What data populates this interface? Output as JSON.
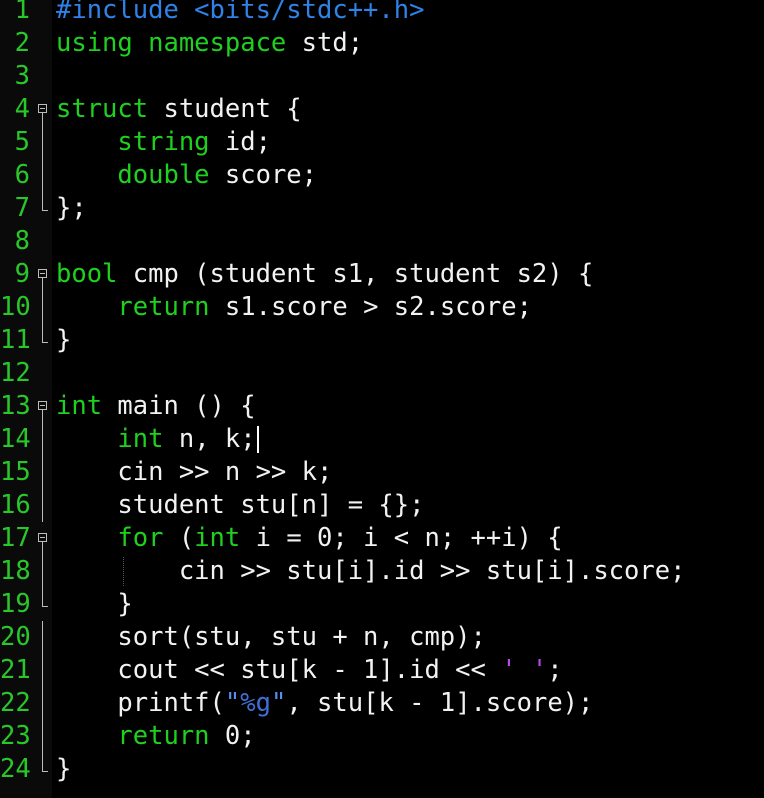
{
  "editor": {
    "colors": {
      "background": "#000000",
      "line_number": "#29c729",
      "preprocessor": "#2f82e6",
      "keyword": "#1fd11f",
      "identifier": "#f2f2f2",
      "string": "#5b8df0",
      "char_literal": "#b84ae0"
    },
    "caret_line": 14,
    "lines": [
      {
        "n": "1",
        "fold": "",
        "tokens": [
          {
            "t": "#include <bits/stdc++.h>",
            "c": "pre"
          }
        ]
      },
      {
        "n": "2",
        "fold": "",
        "tokens": [
          {
            "t": "using namespace",
            "c": "kw"
          },
          {
            "t": " std;",
            "c": "id"
          }
        ]
      },
      {
        "n": "3",
        "fold": "",
        "tokens": []
      },
      {
        "n": "4",
        "fold": "start",
        "tokens": [
          {
            "t": "struct",
            "c": "kw"
          },
          {
            "t": " student {",
            "c": "id"
          }
        ]
      },
      {
        "n": "5",
        "fold": "bar",
        "tokens": [
          {
            "t": "    ",
            "c": "id"
          },
          {
            "t": "string",
            "c": "kw"
          },
          {
            "t": " id;",
            "c": "id"
          }
        ]
      },
      {
        "n": "6",
        "fold": "bar",
        "tokens": [
          {
            "t": "    ",
            "c": "id"
          },
          {
            "t": "double",
            "c": "kw"
          },
          {
            "t": " score;",
            "c": "id"
          }
        ]
      },
      {
        "n": "7",
        "fold": "end",
        "tokens": [
          {
            "t": "};",
            "c": "id"
          }
        ]
      },
      {
        "n": "8",
        "fold": "",
        "tokens": []
      },
      {
        "n": "9",
        "fold": "start",
        "tokens": [
          {
            "t": "bool",
            "c": "kw"
          },
          {
            "t": " cmp (student s1, student s2) {",
            "c": "id"
          }
        ]
      },
      {
        "n": "10",
        "fold": "bar",
        "tokens": [
          {
            "t": "    ",
            "c": "id"
          },
          {
            "t": "return",
            "c": "kw"
          },
          {
            "t": " s1.score > s2.score;",
            "c": "id"
          }
        ]
      },
      {
        "n": "11",
        "fold": "end",
        "tokens": [
          {
            "t": "}",
            "c": "id"
          }
        ]
      },
      {
        "n": "12",
        "fold": "",
        "tokens": []
      },
      {
        "n": "13",
        "fold": "start",
        "tokens": [
          {
            "t": "int",
            "c": "kw"
          },
          {
            "t": " main () {",
            "c": "id"
          }
        ]
      },
      {
        "n": "14",
        "fold": "bar",
        "tokens": [
          {
            "t": "    ",
            "c": "id"
          },
          {
            "t": "int",
            "c": "kw"
          },
          {
            "t": " n, k;",
            "c": "id"
          }
        ]
      },
      {
        "n": "15",
        "fold": "bar",
        "tokens": [
          {
            "t": "    cin >> n >> k;",
            "c": "id"
          }
        ]
      },
      {
        "n": "16",
        "fold": "bar",
        "tokens": [
          {
            "t": "    student stu[n] = {};",
            "c": "id"
          }
        ]
      },
      {
        "n": "17",
        "fold": "start",
        "tokens": [
          {
            "t": "    ",
            "c": "id"
          },
          {
            "t": "for",
            "c": "kw"
          },
          {
            "t": " (",
            "c": "id"
          },
          {
            "t": "int",
            "c": "kw"
          },
          {
            "t": " i = 0; i < n; ++i) {",
            "c": "id"
          }
        ]
      },
      {
        "n": "18",
        "fold": "bar",
        "tokens": [
          {
            "t": "        cin >> stu[i].id >> stu[i].score;",
            "c": "id"
          }
        ]
      },
      {
        "n": "19",
        "fold": "end",
        "tokens": [
          {
            "t": "    }",
            "c": "id"
          }
        ]
      },
      {
        "n": "20",
        "fold": "bar",
        "tokens": [
          {
            "t": "    sort(stu, stu + n, cmp);",
            "c": "id"
          }
        ]
      },
      {
        "n": "21",
        "fold": "bar",
        "tokens": [
          {
            "t": "    cout << stu[k - 1].id << ",
            "c": "id"
          },
          {
            "t": "' '",
            "c": "ch"
          },
          {
            "t": ";",
            "c": "id"
          }
        ]
      },
      {
        "n": "22",
        "fold": "bar",
        "tokens": [
          {
            "t": "    printf(",
            "c": "id"
          },
          {
            "t": "\"",
            "c": "str"
          },
          {
            "t": "%g",
            "c": "fmt"
          },
          {
            "t": "\"",
            "c": "str"
          },
          {
            "t": ", stu[k - 1].score);",
            "c": "id"
          }
        ]
      },
      {
        "n": "23",
        "fold": "bar",
        "tokens": [
          {
            "t": "    ",
            "c": "id"
          },
          {
            "t": "return",
            "c": "kw"
          },
          {
            "t": " 0;",
            "c": "id"
          }
        ]
      },
      {
        "n": "24",
        "fold": "end",
        "tokens": [
          {
            "t": "}",
            "c": "id"
          }
        ]
      }
    ]
  }
}
